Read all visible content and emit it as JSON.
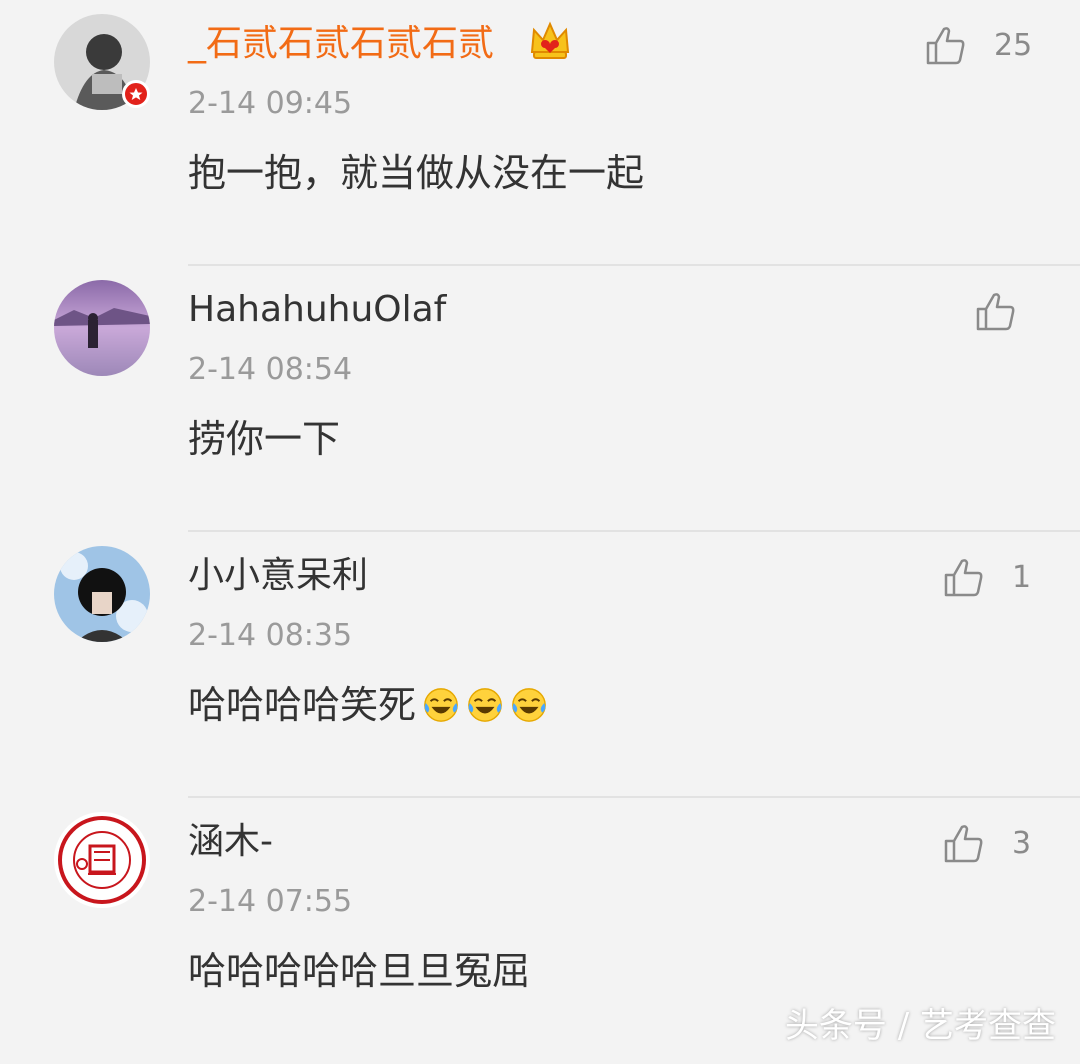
{
  "comments": [
    {
      "username": "_石贰石贰石贰石贰",
      "timestamp": "2-14 09:45",
      "content": "抱一抱，就当做从没在一起",
      "likes": "25",
      "verified": true,
      "crown": true,
      "username_color": "#f26b15"
    },
    {
      "username": "HahahuhuOlaf",
      "timestamp": "2-14 08:54",
      "content": "捞你一下",
      "likes": ""
    },
    {
      "username": "小小意呆利",
      "timestamp": "2-14 08:35",
      "content": "哈哈哈哈笑死",
      "likes": "1",
      "emoji": "laugh-cry-icon"
    },
    {
      "username": "涵木-",
      "timestamp": "2-14 07:55",
      "content": "哈哈哈哈哈旦旦冤屈",
      "likes": "3"
    }
  ],
  "watermark": "头条号 / 艺考查查",
  "colors": {
    "background": "#f3f3f3",
    "accent": "#f26b15",
    "timestamp": "#9a9a9a",
    "divider": "#e2e2e2"
  }
}
